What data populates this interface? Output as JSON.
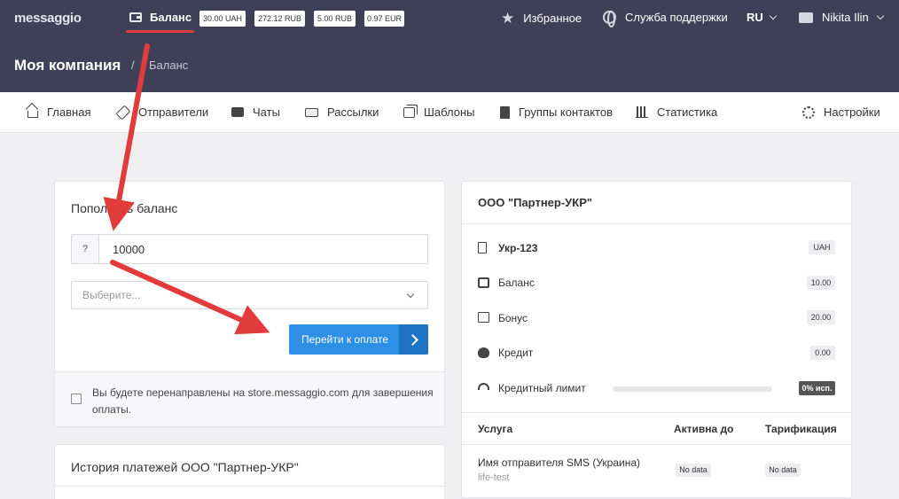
{
  "header": {
    "logo": "messaggio",
    "balance_label": "Баланс",
    "currencies": [
      "30.00 UAH",
      "272.12 RUB",
      "5.00 RUB",
      "0.97 EUR"
    ],
    "favorites": "Избранное",
    "support": "Служба поддержки",
    "language": "RU",
    "user": "Nikita Ilin"
  },
  "breadcrumb": {
    "company": "Моя компания",
    "separator": "/",
    "page": "Баланс"
  },
  "nav": {
    "items": [
      {
        "label": "Главная",
        "icon": "home-icon"
      },
      {
        "label": "Отправители",
        "icon": "tag-icon"
      },
      {
        "label": "Чаты",
        "icon": "chat-icon"
      },
      {
        "label": "Рассылки",
        "icon": "mail-icon"
      },
      {
        "label": "Шаблоны",
        "icon": "template-icon"
      },
      {
        "label": "Группы контактов",
        "icon": "contacts-book-icon"
      },
      {
        "label": "Статистика",
        "icon": "stats-icon"
      }
    ],
    "settings": "Настройки"
  },
  "topup": {
    "title": "Пополнить баланс",
    "addon": "?",
    "amount": "10000",
    "select_placeholder": "Выберите...",
    "pay_button": "Перейти к оплате",
    "note": "Вы будете перенаправлены на store.messaggio.com для завершения оплаты."
  },
  "history": {
    "title": "История платежей ООО \"Партнер-УКР\""
  },
  "partner": {
    "title": "ООО \"Партнер-УКР\"",
    "account": "Укр-123",
    "account_currency": "UAH",
    "rows": [
      {
        "label": "Баланс",
        "value": "10.00",
        "icon": "wallet-icon"
      },
      {
        "label": "Бонус",
        "value": "20.00",
        "icon": "gift-icon"
      },
      {
        "label": "Кредит",
        "value": "0.00",
        "icon": "piggy-bank-icon"
      }
    ],
    "credit_limit_label": "Кредитный лимит",
    "credit_limit_used": "0% исп.",
    "credit_limit_fraction": 0,
    "table": {
      "headers": [
        "Услуга",
        "Активна до",
        "Тарификация"
      ],
      "rows": [
        {
          "service": "Имя отправителя SMS (Украина)",
          "sub": "life-test",
          "active_until": "No data",
          "billing": "No data"
        }
      ]
    }
  },
  "colors": {
    "header_bg": "#3f4058",
    "accent": "#2d8fe6",
    "annotation": "#e23b3b"
  }
}
